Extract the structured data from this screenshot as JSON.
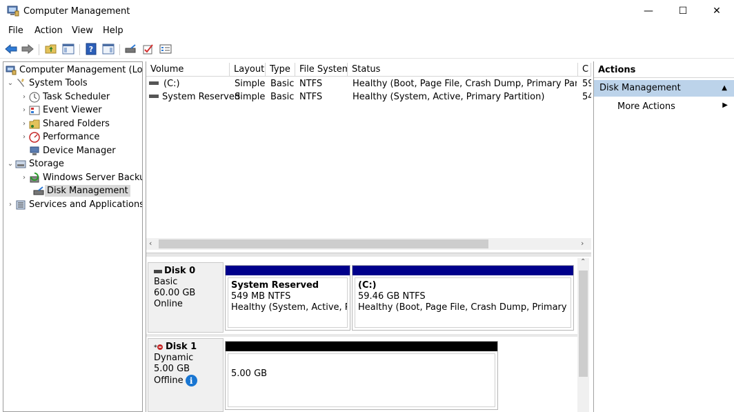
{
  "window": {
    "title": "Computer Management",
    "minimize": "—",
    "maximize": "☐",
    "close": "✕"
  },
  "menu": [
    "File",
    "Action",
    "View",
    "Help"
  ],
  "tree": {
    "root": "Computer Management (Local",
    "system_tools": "System Tools",
    "task_scheduler": "Task Scheduler",
    "event_viewer": "Event Viewer",
    "shared_folders": "Shared Folders",
    "performance": "Performance",
    "device_manager": "Device Manager",
    "storage": "Storage",
    "windows_server_backup": "Windows Server Backup",
    "disk_management": "Disk Management",
    "services_apps": "Services and Applications"
  },
  "volumes": {
    "headers": [
      "Volume",
      "Layout",
      "Type",
      "File System",
      "Status",
      "C"
    ],
    "rows": [
      {
        "volume": "(C:)",
        "layout": "Simple",
        "type": "Basic",
        "fs": "NTFS",
        "status": "Healthy (Boot, Page File, Crash Dump, Primary Partition)",
        "cap": "59"
      },
      {
        "volume": "System Reserved",
        "layout": "Simple",
        "type": "Basic",
        "fs": "NTFS",
        "status": "Healthy (System, Active, Primary Partition)",
        "cap": "54"
      }
    ]
  },
  "disks": {
    "disk0": {
      "name": "Disk 0",
      "type": "Basic",
      "size": "60.00 GB",
      "state": "Online",
      "partitions": [
        {
          "title": "System Reserved",
          "size": "549 MB NTFS",
          "status": "Healthy (System, Active, Prim"
        },
        {
          "title": "(C:)",
          "size": "59.46 GB NTFS",
          "status": "Healthy (Boot, Page File, Crash Dump, Primary Partitic"
        }
      ]
    },
    "disk1": {
      "name": "Disk 1",
      "type": "Dynamic",
      "size": "5.00 GB",
      "state": "Offline",
      "partition_size": "5.00 GB"
    }
  },
  "actions": {
    "title": "Actions",
    "section": "Disk Management",
    "more": "More Actions"
  },
  "colors": {
    "primary_bar": "#00008b",
    "unallocated_bar": "#000000",
    "selection": "#bcd3ea"
  }
}
